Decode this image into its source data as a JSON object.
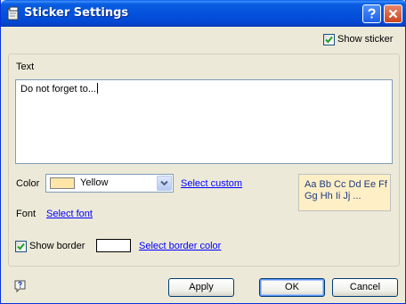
{
  "window": {
    "title": "Sticker Settings"
  },
  "show_sticker": {
    "label": "Show sticker",
    "checked": true
  },
  "text_section": {
    "label": "Text",
    "value": "Do not forget to..."
  },
  "color": {
    "label": "Color",
    "selected": "Yellow",
    "swatch": "#ffe6a8",
    "custom_link": "Select custom"
  },
  "font": {
    "label": "Font",
    "link": "Select font"
  },
  "preview": {
    "line1": "Aa Bb Cc Dd Ee Ff",
    "line2": "Gg Hh Ii Jj ...",
    "background": "#ffefc6"
  },
  "border": {
    "label": "Show border",
    "checked": true,
    "swatch": "#ffffff",
    "link": "Select border color"
  },
  "buttons": {
    "apply": "Apply",
    "ok": "OK",
    "cancel": "Cancel"
  },
  "colors": {
    "titlebar": "#0a5fe0",
    "face": "#ece9d8",
    "link": "#0000ff",
    "check": "#21a121"
  }
}
